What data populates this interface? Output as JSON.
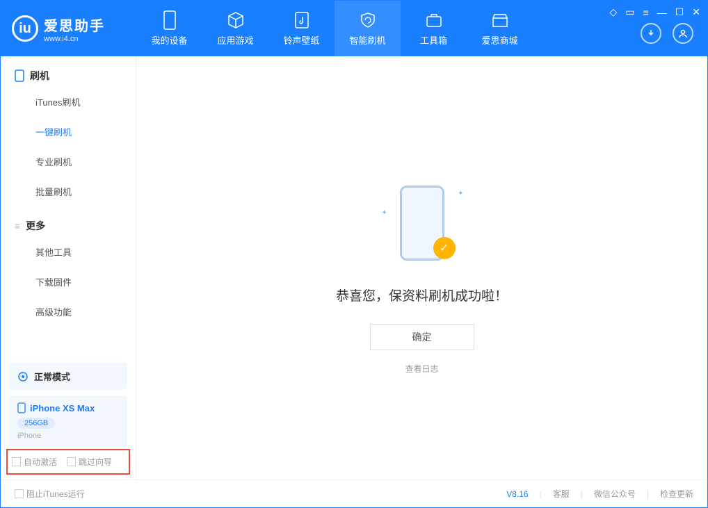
{
  "app": {
    "title": "爱思助手",
    "subtitle": "www.i4.cn"
  },
  "nav": {
    "tabs": [
      {
        "label": "我的设备"
      },
      {
        "label": "应用游戏"
      },
      {
        "label": "铃声壁纸"
      },
      {
        "label": "智能刷机"
      },
      {
        "label": "工具箱"
      },
      {
        "label": "爱思商城"
      }
    ]
  },
  "sidebar": {
    "section1": {
      "title": "刷机"
    },
    "items1": [
      {
        "label": "iTunes刷机"
      },
      {
        "label": "一键刷机"
      },
      {
        "label": "专业刷机"
      },
      {
        "label": "批量刷机"
      }
    ],
    "section2": {
      "title": "更多"
    },
    "items2": [
      {
        "label": "其他工具"
      },
      {
        "label": "下载固件"
      },
      {
        "label": "高级功能"
      }
    ],
    "mode": {
      "label": "正常模式"
    },
    "device": {
      "name": "iPhone XS Max",
      "capacity": "256GB",
      "type": "iPhone"
    },
    "checks": {
      "auto_activate": "自动激活",
      "skip_guide": "跳过向导"
    }
  },
  "main": {
    "success_message": "恭喜您，保资料刷机成功啦！",
    "ok_button": "确定",
    "view_log": "查看日志"
  },
  "statusbar": {
    "block_itunes": "阻止iTunes运行",
    "version": "V8.16",
    "service": "客服",
    "wechat": "微信公众号",
    "check_update": "检查更新"
  }
}
